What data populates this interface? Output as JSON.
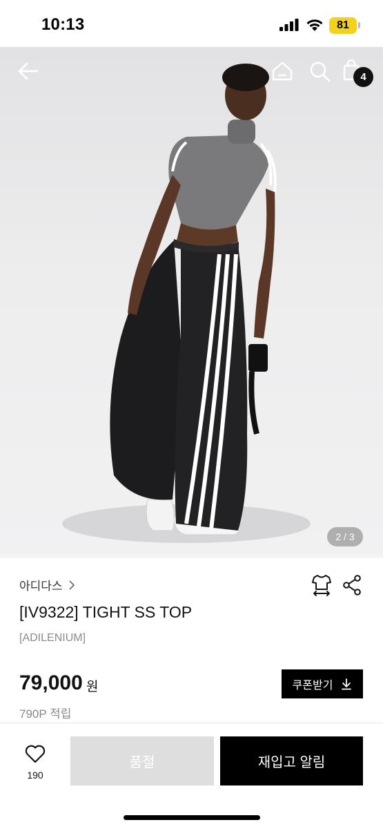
{
  "status_bar": {
    "time": "10:13",
    "battery": "81",
    "battery_color": "#f2d21d"
  },
  "header": {
    "icons": [
      "back-arrow-icon",
      "home-icon",
      "search-icon",
      "shopping-bag-icon"
    ],
    "cart_count": "4"
  },
  "gallery": {
    "page_indicator": "2 / 3"
  },
  "product": {
    "brand": "아디다스",
    "title": "[IV9322] TIGHT SS TOP",
    "subtitle": "[ADILENIUM]",
    "price": "79,000",
    "currency": "원",
    "points": "790P 적립",
    "coupon_label": "쿠폰받기"
  },
  "actions": {
    "like_count": "190",
    "soldout_label": "품절",
    "restock_label": "재입고 알림"
  },
  "colors": {
    "primary": "#000000",
    "soldout_bg": "#dedede"
  }
}
